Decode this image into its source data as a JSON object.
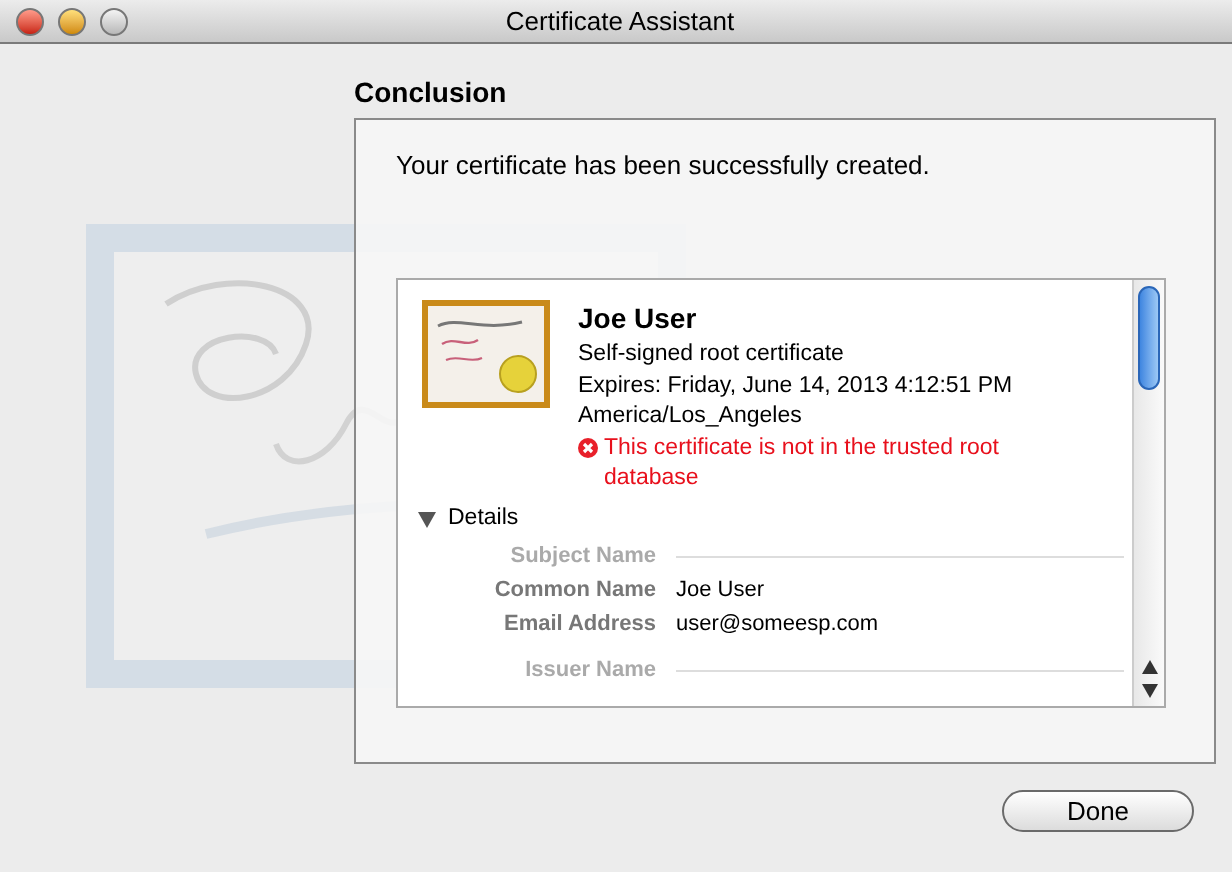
{
  "window": {
    "title": "Certificate Assistant"
  },
  "section_title": "Conclusion",
  "message": "Your certificate has been successfully created.",
  "certificate": {
    "name": "Joe User",
    "type": "Self-signed root certificate",
    "expires": "Expires: Friday, June 14, 2013 4:12:51 PM America/Los_Angeles",
    "warning": "This certificate is not in the trusted root database"
  },
  "details": {
    "label": "Details",
    "expanded": true,
    "sections": [
      {
        "title": "Subject Name",
        "fields": [
          {
            "label": "Common Name",
            "value": "Joe User"
          },
          {
            "label": "Email Address",
            "value": "user@someesp.com"
          }
        ]
      },
      {
        "title": "Issuer Name"
      }
    ]
  },
  "buttons": [
    {
      "label": "Done"
    }
  ]
}
